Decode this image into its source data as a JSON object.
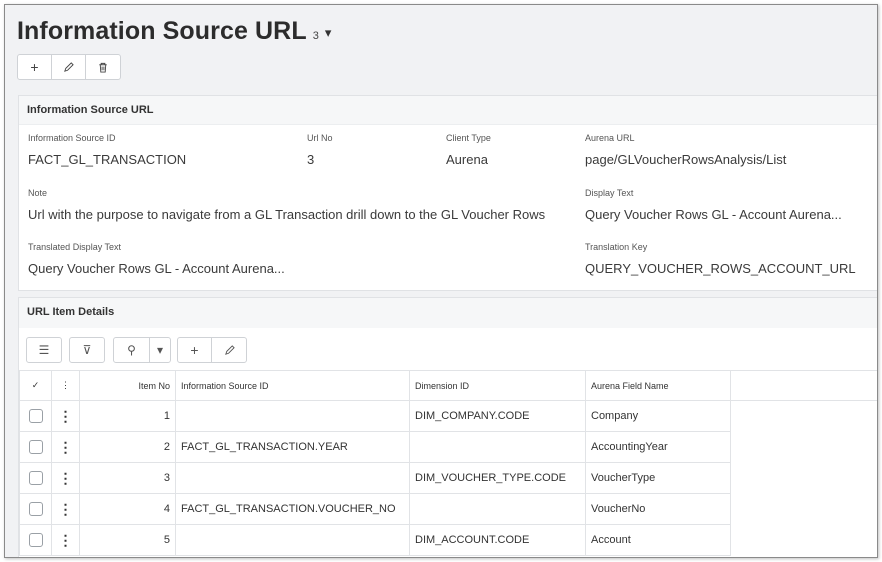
{
  "header": {
    "title": "Information Source URL",
    "count": "3",
    "caret": "▾",
    "toolbar": {
      "add": "+",
      "edit": "✎",
      "delete": "🗑"
    }
  },
  "form": {
    "section_title": "Information Source URL",
    "fields": {
      "info_source_id": {
        "label": "Information Source ID",
        "value": "FACT_GL_TRANSACTION"
      },
      "url_no": {
        "label": "Url No",
        "value": "3"
      },
      "client_type": {
        "label": "Client Type",
        "value": "Aurena"
      },
      "aurena_url": {
        "label": "Aurena URL",
        "value": "page/GLVoucherRowsAnalysis/List"
      },
      "note": {
        "label": "Note",
        "value": "Url with the purpose to navigate from a GL Transaction drill down to the GL Voucher Rows"
      },
      "display_text": {
        "label": "Display Text",
        "value": "Query Voucher Rows GL - Account Aurena..."
      },
      "translated_display_text": {
        "label": "Translated Display Text",
        "value": "Query Voucher Rows GL - Account Aurena..."
      },
      "translation_key": {
        "label": "Translation Key",
        "value": "QUERY_VOUCHER_ROWS_ACCOUNT_URL"
      }
    }
  },
  "details": {
    "section_title": "URL Item Details",
    "toolbar": {
      "list": "☰",
      "filter": "⊽",
      "link": "⚲",
      "dropdown": "▾",
      "add": "+",
      "edit": "✎"
    },
    "columns": {
      "check": "✓",
      "menu": "⋮",
      "item_no": "Item No",
      "info_source_id": "Information Source ID",
      "dimension_id": "Dimension ID",
      "aurena_field": "Aurena Field Name"
    },
    "rows": [
      {
        "item_no": "1",
        "info_source_id": "",
        "dimension_id": "DIM_COMPANY.CODE",
        "aurena_field": "Company"
      },
      {
        "item_no": "2",
        "info_source_id": "FACT_GL_TRANSACTION.YEAR",
        "dimension_id": "",
        "aurena_field": "AccountingYear"
      },
      {
        "item_no": "3",
        "info_source_id": "",
        "dimension_id": "DIM_VOUCHER_TYPE.CODE",
        "aurena_field": "VoucherType"
      },
      {
        "item_no": "4",
        "info_source_id": "FACT_GL_TRANSACTION.VOUCHER_NO",
        "dimension_id": "",
        "aurena_field": "VoucherNo"
      },
      {
        "item_no": "5",
        "info_source_id": "",
        "dimension_id": "DIM_ACCOUNT.CODE",
        "aurena_field": "Account"
      }
    ]
  }
}
